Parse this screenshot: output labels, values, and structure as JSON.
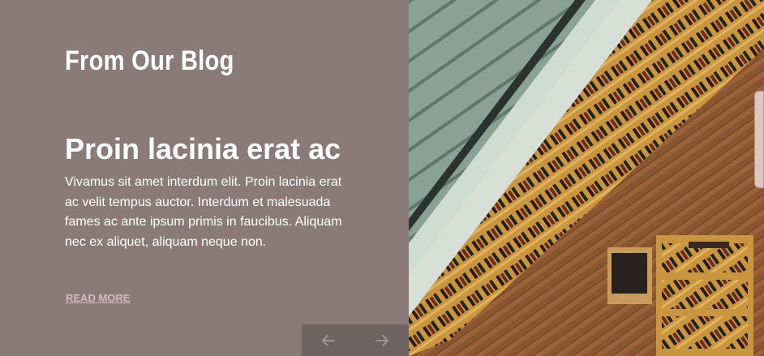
{
  "section": {
    "title": "From Our Blog"
  },
  "post": {
    "title": "Proin lacinia erat ac",
    "excerpt": "Vivamus sit amet interdum elit. Proin lacinia erat ac velit tempus auctor. Interdum et malesuada fames ac ante ipsum primis in faucibus. Aliquam nec ex aliquet, aliquam neque non.",
    "read_more": "READ MORE"
  },
  "nav": {
    "prev_icon": "arrow-left-icon",
    "next_icon": "arrow-right-icon"
  },
  "image": {
    "subject": "wine-store-escalator-photo"
  },
  "colors": {
    "panel": "#8a7b7a",
    "nav_bg": "#6e6262",
    "link": "#d9b8c4",
    "text": "#ffffff"
  }
}
